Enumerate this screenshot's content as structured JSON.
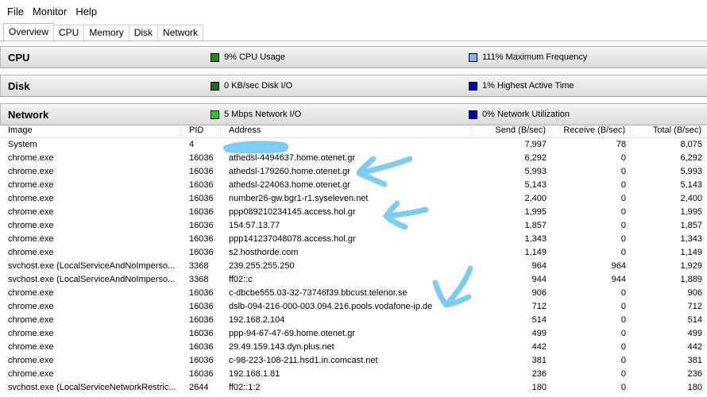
{
  "menu": [
    "File",
    "Monitor",
    "Help"
  ],
  "tabs": [
    "Overview",
    "CPU",
    "Memory",
    "Disk",
    "Network"
  ],
  "sections": {
    "cpu": {
      "title": "CPU",
      "stat1": "9% CPU Usage",
      "stat2": "111% Maximum Frequency",
      "color1": "#1e8a1e",
      "color2": "#7fb7f0"
    },
    "disk": {
      "title": "Disk",
      "stat1": "0 KB/sec Disk I/O",
      "stat2": "1% Highest Active Time",
      "color1": "#1e6a1e",
      "color2": "#0000cc"
    },
    "network": {
      "title": "Network",
      "stat1": "5 Mbps Network I/O",
      "stat2": "0% Network Utilization",
      "color1": "#22cc22",
      "color2": "#0000cc"
    }
  },
  "table": {
    "headers": {
      "image": "Image",
      "pid": "PID",
      "address": "Address",
      "send": "Send (B/sec)",
      "receive": "Receive (B/sec)",
      "total": "Total (B/sec)"
    },
    "rows": [
      {
        "image": "System",
        "pid": "4",
        "address": "",
        "send": "7,997",
        "receive": "78",
        "total": "8,075"
      },
      {
        "image": "chrome.exe",
        "pid": "16036",
        "address": "athedsl-4494637.home.otenet.gr",
        "send": "6,292",
        "receive": "0",
        "total": "6,292"
      },
      {
        "image": "chrome.exe",
        "pid": "16036",
        "address": "athedsl-179260.home.otenet.gr",
        "send": "5,993",
        "receive": "0",
        "total": "5,993"
      },
      {
        "image": "chrome.exe",
        "pid": "16036",
        "address": "athedsl-224063.home.otenet.gr",
        "send": "5,143",
        "receive": "0",
        "total": "5,143"
      },
      {
        "image": "chrome.exe",
        "pid": "16036",
        "address": "number26-gw.bgr1-r1.syseleven.net",
        "send": "2,400",
        "receive": "0",
        "total": "2,400"
      },
      {
        "image": "chrome.exe",
        "pid": "16036",
        "address": "ppp089210234145.access.hol.gr",
        "send": "1,995",
        "receive": "0",
        "total": "1,995"
      },
      {
        "image": "chrome.exe",
        "pid": "16036",
        "address": "154.57.13.77",
        "send": "1,857",
        "receive": "0",
        "total": "1,857"
      },
      {
        "image": "chrome.exe",
        "pid": "16036",
        "address": "ppp141237048078.access.hol.gr",
        "send": "1,343",
        "receive": "0",
        "total": "1,343"
      },
      {
        "image": "chrome.exe",
        "pid": "16036",
        "address": "s2.hosthorde.com",
        "send": "1,149",
        "receive": "0",
        "total": "1,149"
      },
      {
        "image": "svchost.exe (LocalServiceAndNoImperso...",
        "pid": "3368",
        "address": "239.255.255.250",
        "send": "964",
        "receive": "964",
        "total": "1,929"
      },
      {
        "image": "svchost.exe (LocalServiceAndNoImperso...",
        "pid": "3368",
        "address": "ff02::c",
        "send": "944",
        "receive": "944",
        "total": "1,889"
      },
      {
        "image": "chrome.exe",
        "pid": "16036",
        "address": "c-dbcbe555.03-32-73746f39.bbcust.telenor.se",
        "send": "906",
        "receive": "0",
        "total": "906"
      },
      {
        "image": "chrome.exe",
        "pid": "16036",
        "address": "dslb-094-216-000-003.094.216.pools.vodafone-ip.de",
        "send": "712",
        "receive": "0",
        "total": "712"
      },
      {
        "image": "chrome.exe",
        "pid": "16036",
        "address": "192.168.2.104",
        "send": "514",
        "receive": "0",
        "total": "514"
      },
      {
        "image": "chrome.exe",
        "pid": "16036",
        "address": "ppp-94-67-47-69.home.otenet.gr",
        "send": "499",
        "receive": "0",
        "total": "499"
      },
      {
        "image": "chrome.exe",
        "pid": "16036",
        "address": "29.49.159.143.dyn.plus.net",
        "send": "442",
        "receive": "0",
        "total": "442"
      },
      {
        "image": "chrome.exe",
        "pid": "16036",
        "address": "c-98-223-108-211.hsd1.in.comcast.net",
        "send": "381",
        "receive": "0",
        "total": "381"
      },
      {
        "image": "chrome.exe",
        "pid": "16036",
        "address": "192.168.1.81",
        "send": "236",
        "receive": "0",
        "total": "236"
      },
      {
        "image": "svchost.exe (LocalServiceNetworkRestric...",
        "pid": "2644",
        "address": "ff02::1:2",
        "send": "180",
        "receive": "0",
        "total": "180"
      }
    ]
  },
  "annotation_color": "#7ccdf2"
}
